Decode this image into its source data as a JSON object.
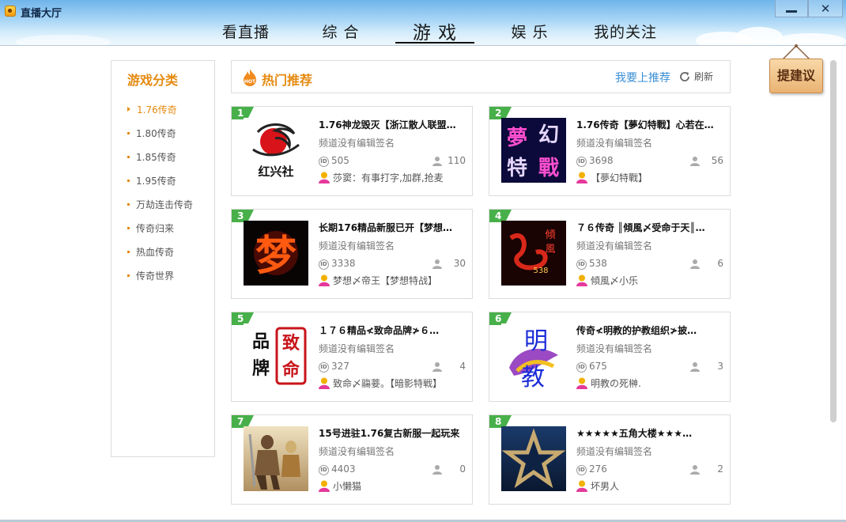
{
  "window": {
    "title": "直播大厅",
    "minimize_icon": "minimize-icon",
    "close_label": "✕"
  },
  "nav": {
    "tabs": [
      {
        "label": "看直播"
      },
      {
        "label": "综 合"
      },
      {
        "label": "游 戏"
      },
      {
        "label": "娱 乐"
      },
      {
        "label": "我的关注"
      }
    ],
    "active_tab": "游 戏"
  },
  "sidebar": {
    "title": "游戏分类",
    "items": [
      "1.76传奇",
      "1.80传奇",
      "1.85传奇",
      "1.95传奇",
      "万劫连击传奇",
      "传奇归来",
      "热血传奇",
      "传奇世界"
    ],
    "active_item": "1.76传奇"
  },
  "hot": {
    "title": "热门推荐",
    "recommend_link": "我要上推荐",
    "refresh_label": "刷新"
  },
  "suggest_button": "提建议",
  "channels": [
    {
      "rank": "1",
      "title": "1.76神龙毁灭【浙江散人联盟…",
      "signature": "频道没有编辑签名",
      "id": "505",
      "viewers": "110",
      "host": "莎窦：有事打字,加群,抢麦",
      "thumb_text": "红兴社"
    },
    {
      "rank": "2",
      "title": "1.76传奇【夢幻特戰】心若在…",
      "signature": "频道没有编辑签名",
      "id": "3698",
      "viewers": "56",
      "host": "【夢幻特戰】",
      "thumb_text": "夢幻特戰"
    },
    {
      "rank": "3",
      "title": "长期176精品新服已开【梦想…",
      "signature": "频道没有编辑签名",
      "id": "3338",
      "viewers": "30",
      "host": "梦想〆帝王【梦想特战】",
      "thumb_text": "梦"
    },
    {
      "rank": "4",
      "title": "７６传奇 ║傾風〆受命于天║…",
      "signature": "频道没有编辑签名",
      "id": "538",
      "viewers": "6",
      "host": "傾風〆小乐",
      "thumb_text": "傾風"
    },
    {
      "rank": "5",
      "title": "１７６精品≮致命品牌≯６…",
      "signature": "频道没有编辑签名",
      "id": "327",
      "viewers": "4",
      "host": "致命〆鬺菨。【暗影特戦】",
      "thumb_text": "品牌致命"
    },
    {
      "rank": "6",
      "title": "传奇≮明教的护教组织≯披…",
      "signature": "频道没有编辑签名",
      "id": "675",
      "viewers": "3",
      "host": "明教の死榊.",
      "thumb_text": "明教"
    },
    {
      "rank": "7",
      "title": "15号进驻1.76复古新服一起玩来",
      "signature": "频道没有编辑签名",
      "id": "4403",
      "viewers": "0",
      "host": "小懒猫",
      "thumb_text": ""
    },
    {
      "rank": "8",
      "title": "★★★★★五角大楼★★★…",
      "signature": "频道没有编辑签名",
      "id": "276",
      "viewers": "2",
      "host": "坏男人",
      "thumb_text": ""
    }
  ],
  "colors": {
    "accent_orange": "#e58a10",
    "link_blue": "#3a8fd6",
    "rank_green": "#48b04a"
  }
}
